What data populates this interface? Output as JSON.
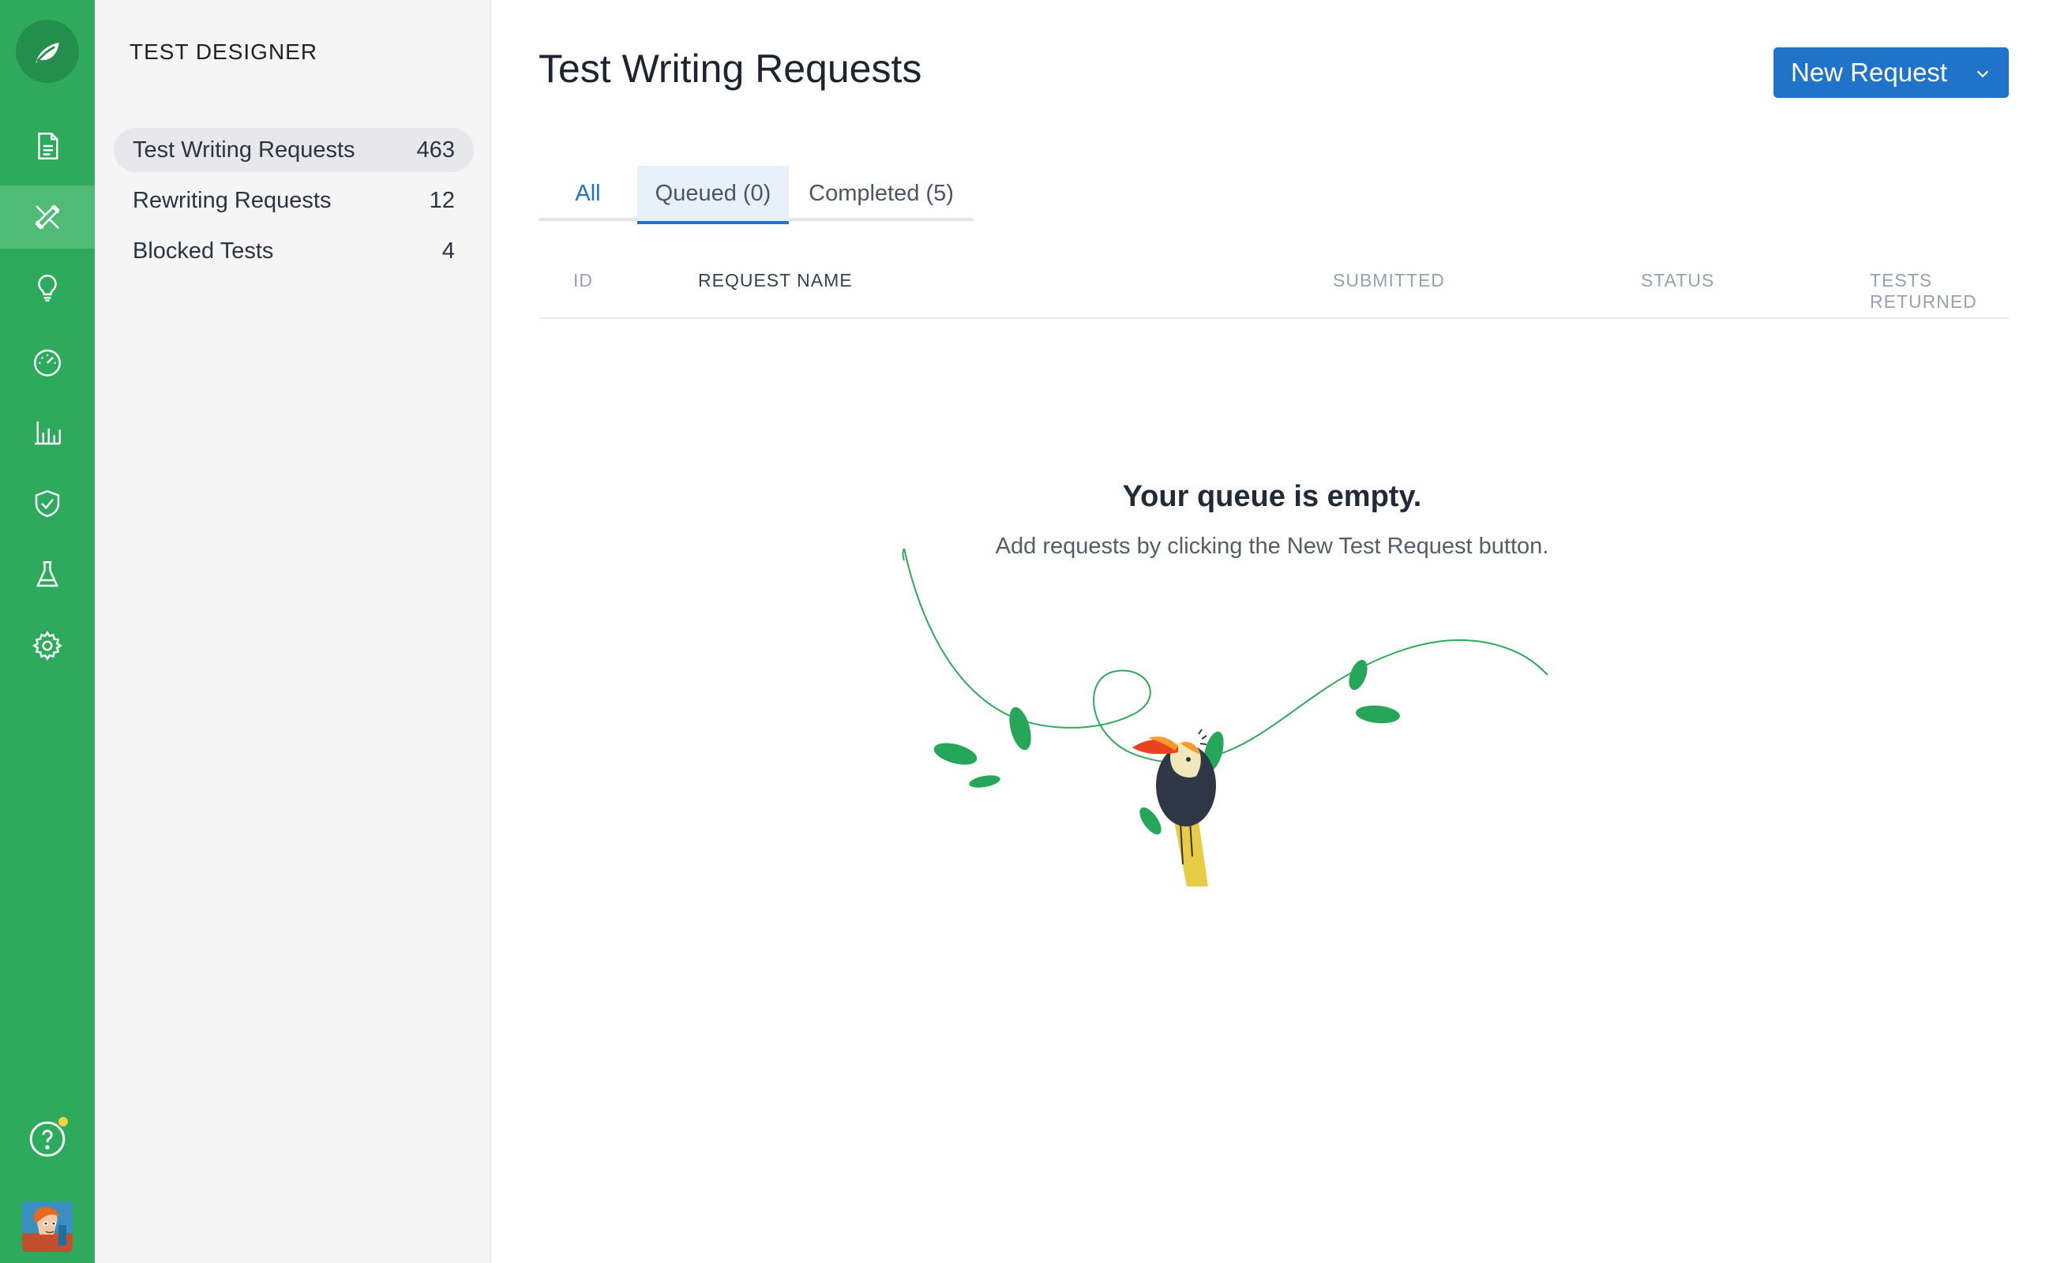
{
  "sidebar": {
    "section_title": "TEST DESIGNER",
    "items": [
      {
        "label": "Test Writing Requests",
        "count": "463"
      },
      {
        "label": "Rewriting Requests",
        "count": "12"
      },
      {
        "label": "Blocked Tests",
        "count": "4"
      }
    ]
  },
  "rail": {
    "icons": [
      "leaf-logo-icon",
      "document-icon",
      "design-tools-icon",
      "lightbulb-icon",
      "dashboard-gauge-icon",
      "bar-chart-icon",
      "shield-check-icon",
      "flask-icon",
      "gear-icon",
      "help-icon"
    ],
    "active": "design-tools-icon",
    "accent": "#2eaa5c",
    "notification_color": "#f5d33b"
  },
  "main": {
    "title": "Test Writing Requests",
    "new_request_label": "New Request",
    "tabs": [
      {
        "label": "All"
      },
      {
        "label": "Queued (0)"
      },
      {
        "label": "Completed (5)"
      }
    ],
    "active_tab": "Queued (0)",
    "columns": [
      "ID",
      "REQUEST NAME",
      "SUBMITTED",
      "STATUS",
      "TESTS RETURNED"
    ],
    "empty_title": "Your queue is empty.",
    "empty_subtitle": "Add requests by clicking the New Test Request button."
  },
  "colors": {
    "primary": "#1f73c8",
    "brand_green": "#2eaa5c"
  }
}
